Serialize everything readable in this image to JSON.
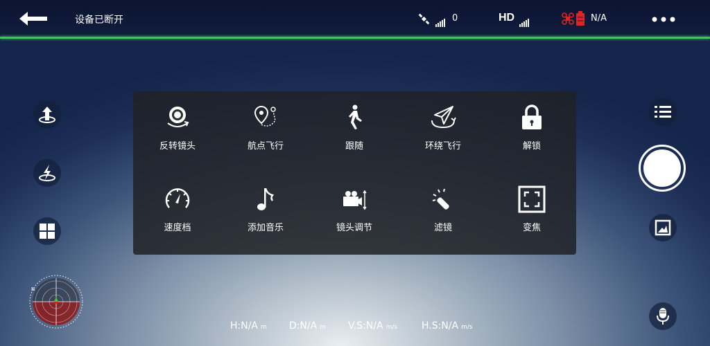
{
  "topbar": {
    "status": "设备已断开",
    "satellite_count": "0",
    "hd_label": "HD",
    "battery": "N/A"
  },
  "menu": {
    "items": [
      {
        "label": "反转镜头",
        "icon": "flip-camera-icon"
      },
      {
        "label": "航点飞行",
        "icon": "waypoint-icon"
      },
      {
        "label": "跟随",
        "icon": "walking-person-icon"
      },
      {
        "label": "环绕飞行",
        "icon": "orbit-icon"
      },
      {
        "label": "解锁",
        "icon": "lock-icon"
      },
      {
        "label": "速度档",
        "icon": "speedometer-icon"
      },
      {
        "label": "添加音乐",
        "icon": "music-note-icon"
      },
      {
        "label": "镜头调节",
        "icon": "video-camera-adjust-icon"
      },
      {
        "label": "滤镜",
        "icon": "magic-wand-icon"
      },
      {
        "label": "变焦",
        "icon": "zoom-frame-icon"
      }
    ]
  },
  "telemetry": {
    "h_value": "H:N/A",
    "h_unit": "m",
    "d_value": "D:N/A",
    "d_unit": "m",
    "vs_value": "V.S:N/A",
    "vs_unit": "m/s",
    "hs_value": "H.S:N/A",
    "hs_unit": "m/s"
  },
  "colors": {
    "accent_green": "#33d14a",
    "warning_red": "#e02424"
  }
}
